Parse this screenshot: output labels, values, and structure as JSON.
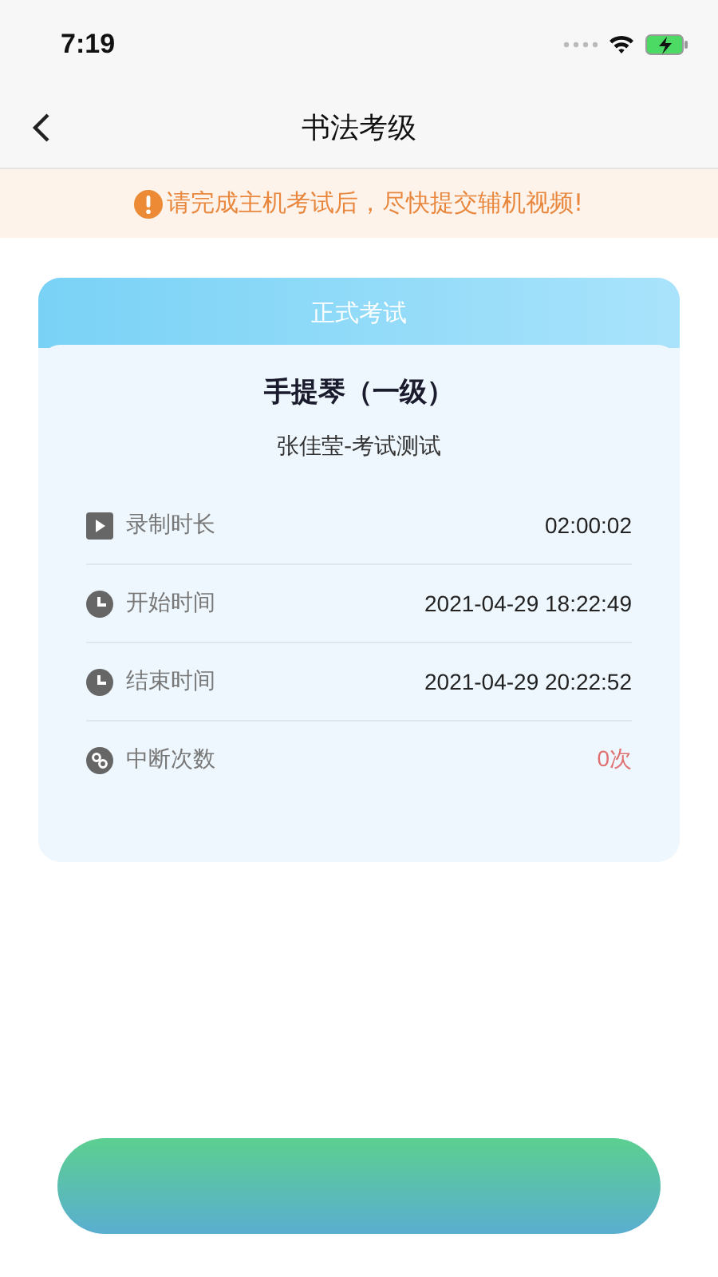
{
  "status_bar": {
    "time": "7:19"
  },
  "nav": {
    "title": "书法考级"
  },
  "notice": {
    "text": "请完成主机考试后，尽快提交辅机视频!"
  },
  "card": {
    "header": "正式考试",
    "title": "手提琴（一级）",
    "subtitle": "张佳莹-考试测试",
    "rows": [
      {
        "kind": "duration",
        "label": "录制时长",
        "value": "02:00:02",
        "alert": false
      },
      {
        "kind": "time",
        "label": "开始时间",
        "value": "2021-04-29 18:22:49",
        "alert": false
      },
      {
        "kind": "time",
        "label": "结束时间",
        "value": "2021-04-29 20:22:52",
        "alert": false
      },
      {
        "kind": "count",
        "label": "中断次数",
        "value": "0次",
        "alert": true
      }
    ]
  },
  "bottom_button": {
    "kind": "gradient"
  }
}
